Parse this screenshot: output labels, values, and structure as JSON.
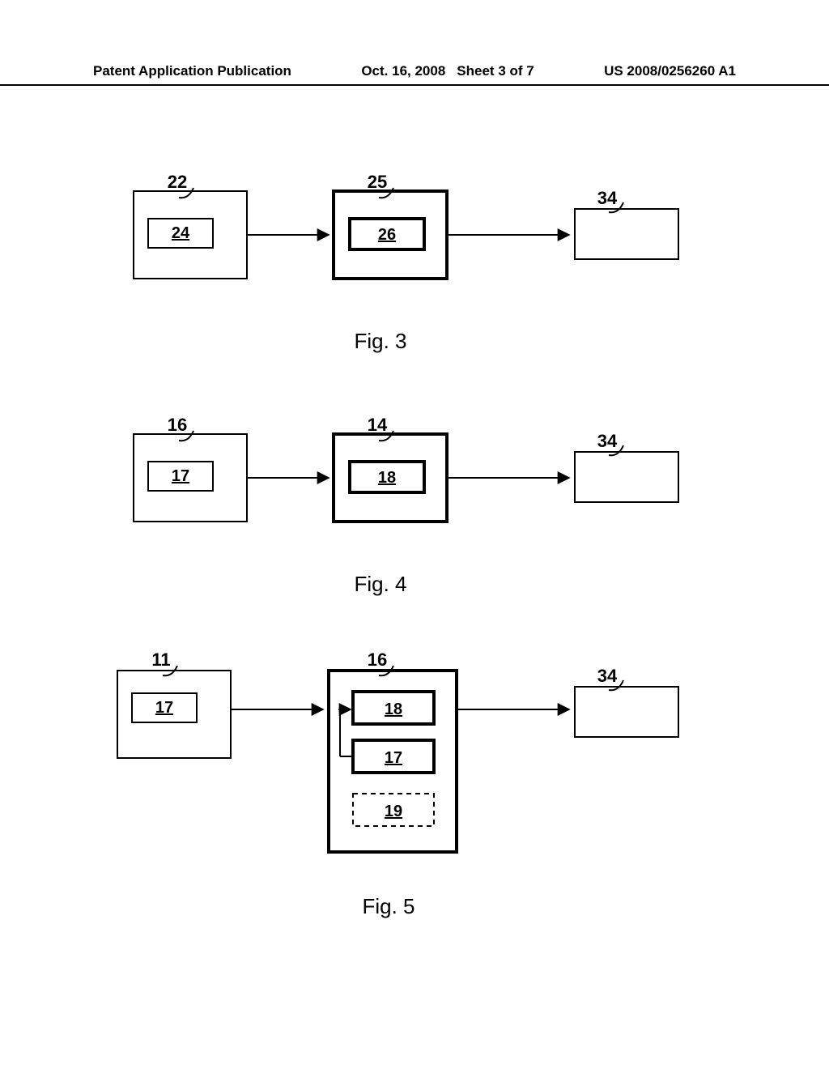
{
  "header": {
    "left": "Patent Application Publication",
    "date": "Oct. 16, 2008",
    "sheet": "Sheet 3 of 7",
    "right": "US 2008/0256260 A1"
  },
  "fig3": {
    "caption": "Fig. 3",
    "box1": {
      "ref": "22",
      "inner": "24"
    },
    "box2": {
      "ref": "25",
      "inner": "26"
    },
    "box3": {
      "ref": "34"
    }
  },
  "fig4": {
    "caption": "Fig. 4",
    "box1": {
      "ref": "16",
      "inner": "17"
    },
    "box2": {
      "ref": "14",
      "inner": "18"
    },
    "box3": {
      "ref": "34"
    }
  },
  "fig5": {
    "caption": "Fig. 5",
    "box1": {
      "ref": "11",
      "inner": "17"
    },
    "box2": {
      "ref": "16",
      "inner1": "18",
      "inner2": "17",
      "inner3": "19"
    },
    "box3": {
      "ref": "34"
    }
  }
}
